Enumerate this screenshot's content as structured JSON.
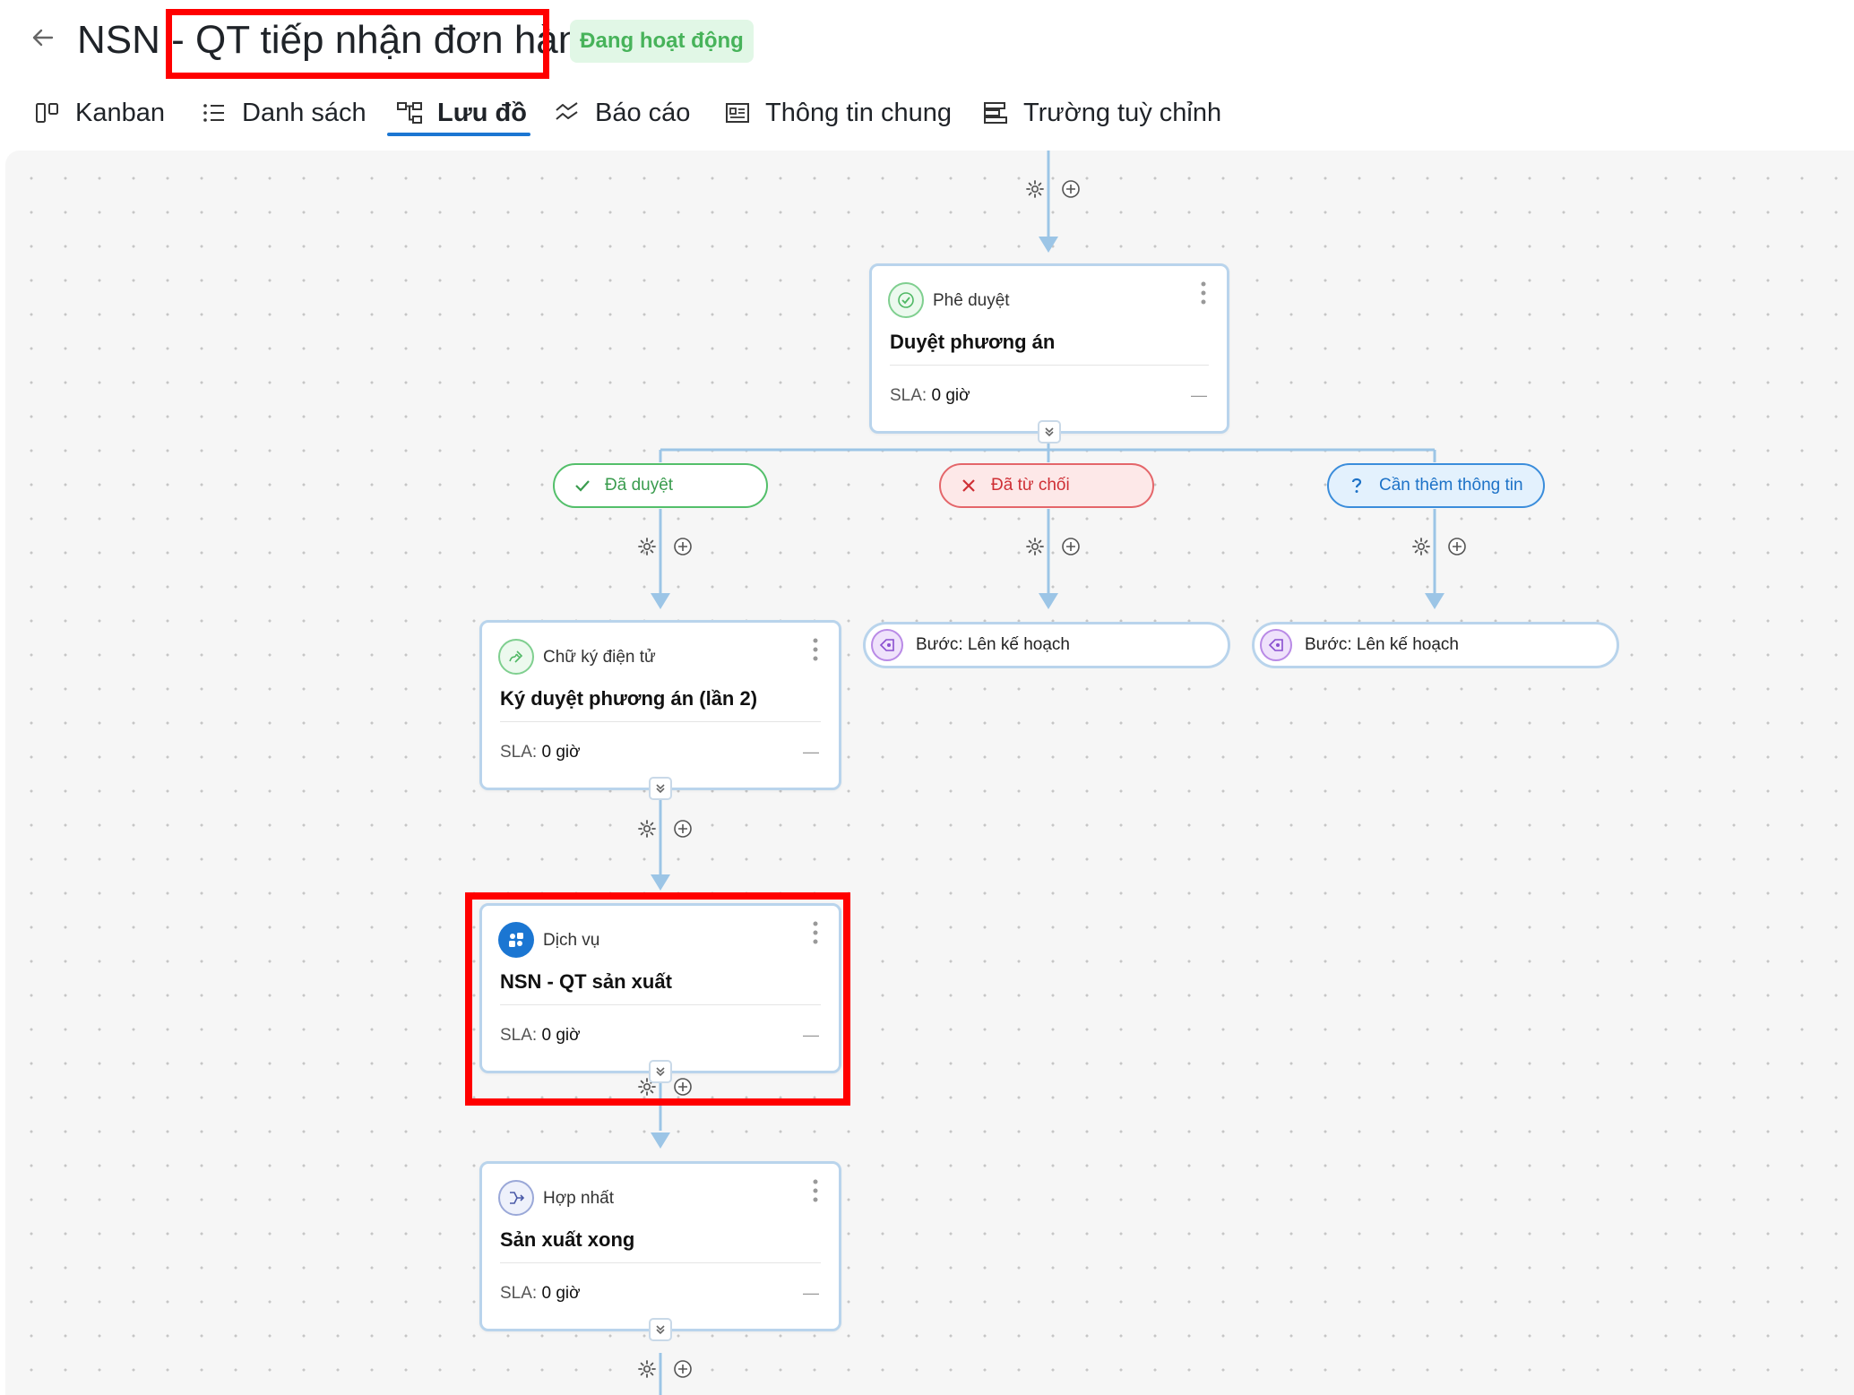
{
  "header": {
    "title": "NSN - QT tiếp nhận đơn hàng",
    "status": "Đang hoạt động"
  },
  "tabs": [
    {
      "label": "Kanban",
      "icon": "kanban-icon"
    },
    {
      "label": "Danh sách",
      "icon": "list-icon"
    },
    {
      "label": "Lưu đồ",
      "icon": "flowchart-icon",
      "active": true
    },
    {
      "label": "Báo cáo",
      "icon": "report-icon"
    },
    {
      "label": "Thông tin chung",
      "icon": "info-icon"
    },
    {
      "label": "Trường tuỳ chỉnh",
      "icon": "custom-field-icon"
    }
  ],
  "nodes": {
    "approval": {
      "type": "Phê duyệt",
      "name": "Duyệt phương án",
      "sla_label": "SLA:",
      "sla_value": "0 giờ",
      "dash": "—"
    },
    "signature": {
      "type": "Chữ ký điện tử",
      "name": "Ký duyệt phương án (lần 2)",
      "sla_label": "SLA:",
      "sla_value": "0 giờ",
      "dash": "—"
    },
    "service": {
      "type": "Dịch vụ",
      "name": "NSN - QT sản xuất",
      "sla_label": "SLA:",
      "sla_value": "0 giờ",
      "dash": "—"
    },
    "merge": {
      "type": "Hợp nhất",
      "name": "Sản xuất xong",
      "sla_label": "SLA:",
      "sla_value": "0 giờ",
      "dash": "—"
    }
  },
  "branches": {
    "approved": "Đã duyệt",
    "rejected": "Đã từ chối",
    "need_info": "Cần thêm thông tin"
  },
  "steps": {
    "plan_1": "Bước: Lên kế hoạch",
    "plan_2": "Bước: Lên kế hoạch"
  },
  "colors": {
    "accent": "#1b76d2",
    "connector": "#9cc5e6",
    "highlight": "#ff0000",
    "approved": "#3a9c4e",
    "rejected": "#cf2f35",
    "info": "#1d72c7"
  }
}
